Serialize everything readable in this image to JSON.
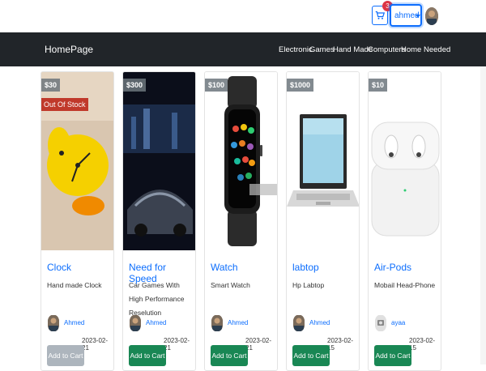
{
  "header": {
    "cart_count": "3",
    "username": "ahmed"
  },
  "navbar": {
    "brand": "HomePage",
    "links": [
      "Electronic",
      "Games",
      "Hand Made",
      "Computers",
      "Home Needed"
    ]
  },
  "products": [
    {
      "price": "$30",
      "badge": "Out Of Stock",
      "title": "Clock",
      "description": "Hand made Clock",
      "owner": "Ahmed",
      "date": "2023-02-21",
      "button": "Add to Cart"
    },
    {
      "price": "$300",
      "badge": "",
      "title": "Need for Speed",
      "description": "Car Games With High Performance Reselution",
      "owner": "Ahmed",
      "date": "2023-02-21",
      "button": "Add to Cart"
    },
    {
      "price": "$100",
      "badge": "",
      "title": "Watch",
      "description": "Smart Watch",
      "owner": "Ahmed",
      "date": "2023-02-21",
      "button": "Add to Cart"
    },
    {
      "price": "$1000",
      "badge": "",
      "title": "labtop",
      "description": "Hp Labtop",
      "owner": "Ahmed",
      "date": "2023-02-15",
      "button": "Add to Cart"
    },
    {
      "price": "$10",
      "badge": "",
      "title": "Air-Pods",
      "description": "Mobail Head-Phone",
      "owner": "ayaa",
      "date": "2023-02-15",
      "button": "Add to Cart"
    }
  ],
  "icons": [
    "cart-icon",
    "caret-down-icon",
    "clock-image",
    "game-image",
    "watch-image",
    "laptop-image",
    "airpods-image"
  ],
  "colors": {
    "navbar": "#212529",
    "link": "#0d6efd",
    "add_button": "#198754",
    "disabled_button": "#adb5bd",
    "badge": "#dc3545"
  }
}
